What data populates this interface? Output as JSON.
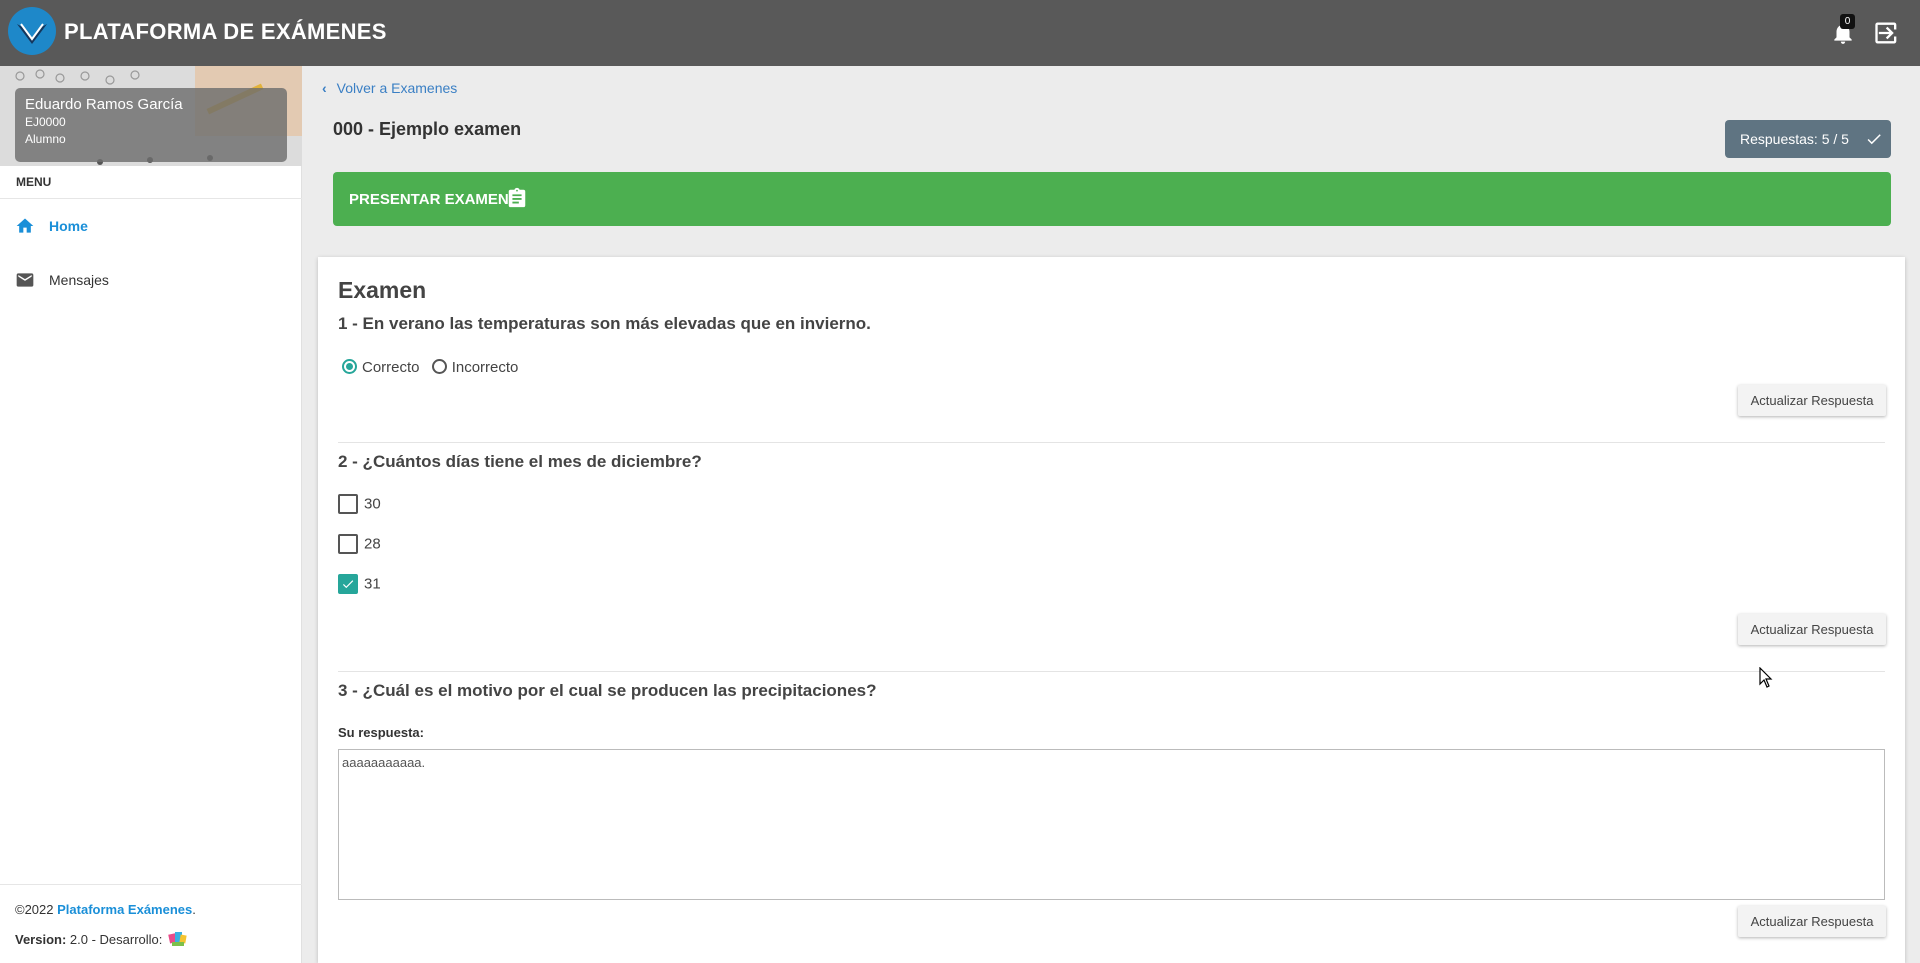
{
  "app": {
    "title": "PLATAFORMA DE EXÁMENES",
    "notification_count": "0"
  },
  "user": {
    "name": "Eduardo Ramos García",
    "id": "EJ0000",
    "role": "Alumno"
  },
  "sidebar": {
    "menu_label": "MENU",
    "items": [
      {
        "label": "Home",
        "icon": "home-icon",
        "active": true
      },
      {
        "label": "Mensajes",
        "icon": "mail-icon",
        "active": false
      }
    ],
    "footer": {
      "copyright": "©2022",
      "brand_link": "Plataforma Exámenes",
      "period": ".",
      "version_label": "Version:",
      "version_value": "2.0 - Desarrollo:"
    }
  },
  "header": {
    "back_link": "Volver a Examenes",
    "exam_title": "000 - Ejemplo examen",
    "responses_badge": "Respuestas: 5 / 5",
    "present_button": "PRESENTAR EXAMEN"
  },
  "exam": {
    "heading": "Examen",
    "update_label": "Actualizar Respuesta",
    "questions": [
      {
        "text": "1 - En verano las temperaturas son más elevadas que en invierno.",
        "type": "radio",
        "options": [
          {
            "label": "Correcto",
            "selected": true
          },
          {
            "label": "Incorrecto",
            "selected": false
          }
        ]
      },
      {
        "text": "2 - ¿Cuántos días tiene el mes de diciembre?",
        "type": "checkbox",
        "options": [
          {
            "label": "30",
            "checked": false
          },
          {
            "label": "28",
            "checked": false
          },
          {
            "label": "31",
            "checked": true
          }
        ]
      },
      {
        "text": "3 - ¿Cuál es el motivo por el cual se producen las precipitaciones?",
        "type": "text",
        "answer_label": "Su respuesta:",
        "answer_value": "aaaaaaaaaaa."
      }
    ]
  },
  "colors": {
    "topbar": "#595959",
    "accent_blue": "#1a8fd8",
    "present_green": "#4caf50",
    "badge_slate": "#5f7482",
    "check_teal": "#26a69a"
  }
}
